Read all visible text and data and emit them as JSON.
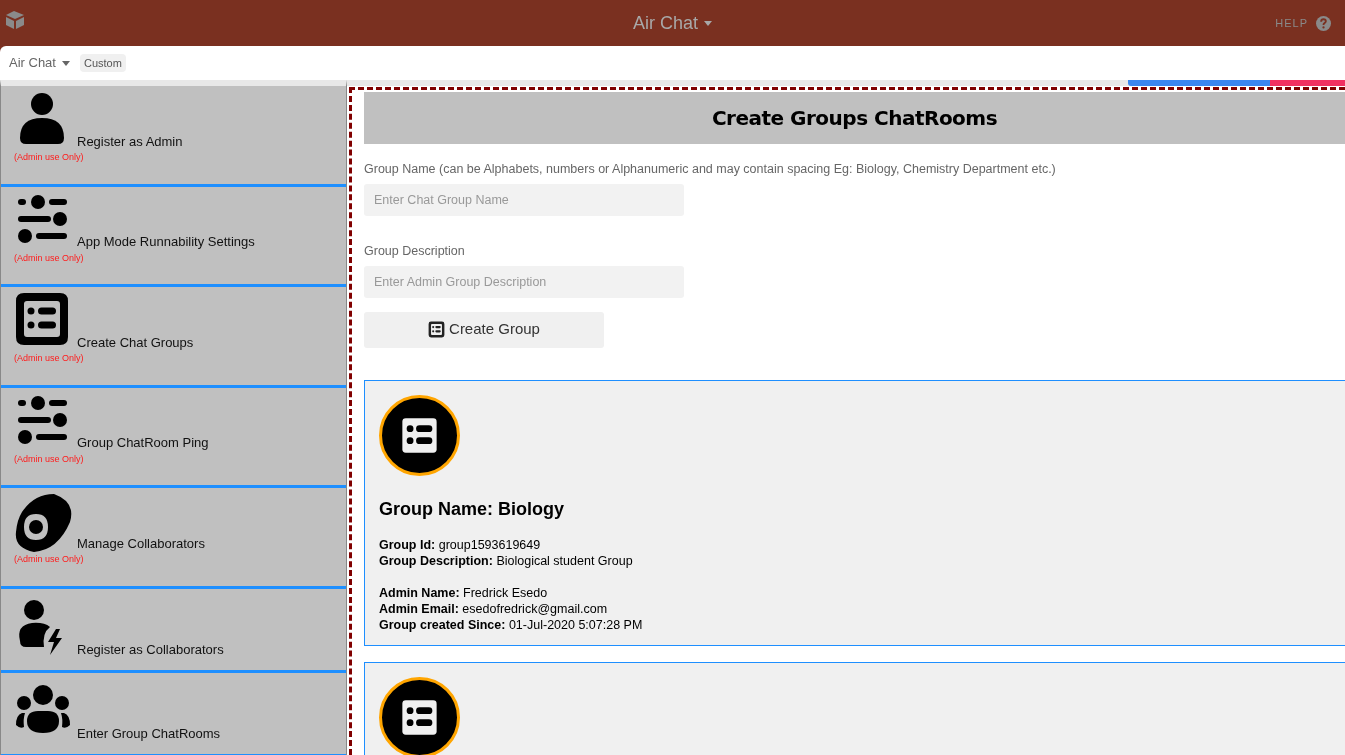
{
  "top_bar": {
    "title": "Air Chat",
    "help": "HELP"
  },
  "app_bar": {
    "app_name": "Air Chat",
    "tag": "Custom"
  },
  "sidebar": {
    "items": [
      {
        "kind": "person",
        "label": "Register as Admin",
        "note": "(Admin use Only)"
      },
      {
        "kind": "sliders",
        "label": "App Mode Runnability Settings",
        "note": "(Admin use Only)"
      },
      {
        "kind": "list",
        "label": "Create Chat Groups",
        "note": "(Admin use Only)"
      },
      {
        "kind": "sliders",
        "label": "Group ChatRoom Ping",
        "note": "(Admin use Only)"
      },
      {
        "kind": "toggle",
        "label": "Manage Collaborators",
        "note": "(Admin use Only)"
      },
      {
        "kind": "person-bolt",
        "label": "Register as Collaborators"
      },
      {
        "kind": "people",
        "label": "Enter Group ChatRooms"
      }
    ]
  },
  "form": {
    "heading": "Create Groups ChatRooms",
    "fields": [
      {
        "label": "Group Name (can be Alphabets, numbers or Alphanumeric and may contain spacing Eg: Biology, Chemistry Department etc.)",
        "placeholder": "Enter Chat Group Name"
      },
      {
        "label": "Group Description",
        "placeholder": "Enter Admin Group Description"
      }
    ],
    "button": "Create Group"
  },
  "groups": [
    {
      "title": "Group Name: Biology",
      "details": [
        [
          {
            "label": "Group Id:",
            "value": "group1593619649"
          },
          {
            "label": "Group Description:",
            "value": "Biological student Group"
          }
        ],
        [
          {
            "label": "Admin Name:",
            "value": "Fredrick Esedo"
          },
          {
            "label": "Admin Email:",
            "value": "esedofredrick@gmail.com"
          },
          {
            "label": "Group created Since:",
            "value": "01-Jul-2020 5:07:28 PM"
          }
        ]
      ]
    },
    {
      "cut_off": true
    }
  ]
}
